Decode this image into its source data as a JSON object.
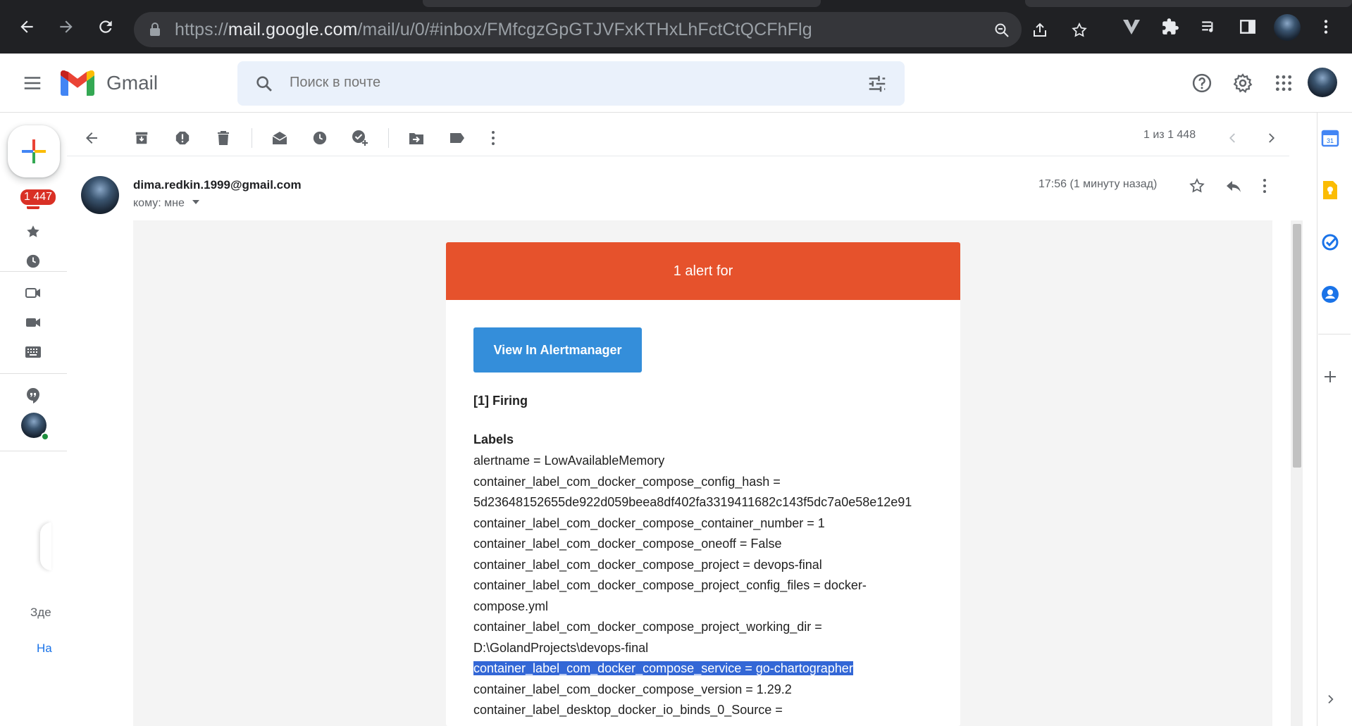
{
  "browser": {
    "url_scheme": "https://",
    "url_host": "mail.google.com",
    "url_path": "/mail/u/0/#inbox/FMfcgzGpGTJVFxKTHxLhFctCtQCFhFlg"
  },
  "gmail": {
    "logo_text": "Gmail",
    "search_placeholder": "Поиск в почте",
    "unread_badge": "1 447",
    "pager": "1 из 1 448",
    "rail_text_1": "Зде",
    "rail_text_2": "На"
  },
  "message": {
    "sender": "dima.redkin.1999@gmail.com",
    "to": "кому: мне",
    "time": "17:56 (1 минуту назад)"
  },
  "alert": {
    "header": "1 alert for",
    "button": "View In Alertmanager",
    "firing": "[1] Firing",
    "labels_title": "Labels",
    "lines": [
      "alertname = LowAvailableMemory",
      "container_label_com_docker_compose_config_hash =",
      "5d23648152655de922d059beea8df402fa3319411682c143f5dc7a0e58e12e91",
      "container_label_com_docker_compose_container_number = 1",
      "container_label_com_docker_compose_oneoff = False",
      "container_label_com_docker_compose_project = devops-final",
      "container_label_com_docker_compose_project_config_files = docker-",
      "compose.yml",
      "container_label_com_docker_compose_project_working_dir =",
      "D:\\GolandProjects\\devops-final",
      "container_label_com_docker_compose_service = go-chartographer",
      "container_label_com_docker_compose_version = 1.29.2",
      "container_label_desktop_docker_io_binds_0_Source ="
    ]
  },
  "colors": {
    "alert_header": "#e6522c",
    "alert_button": "#348eda",
    "selection": "#3367d6",
    "chrome_bg": "#202124"
  }
}
